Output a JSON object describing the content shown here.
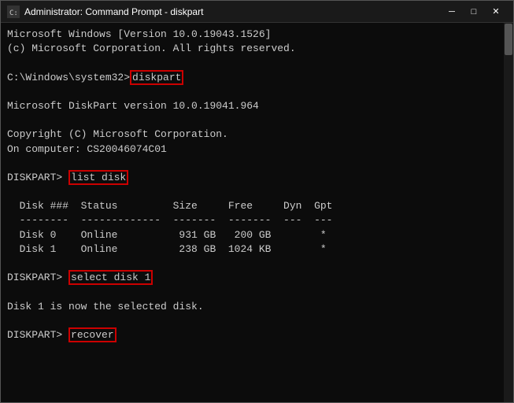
{
  "window": {
    "title": "Administrator: Command Prompt - diskpart",
    "icon": "▶"
  },
  "titlebar": {
    "minimize": "─",
    "maximize": "□",
    "close": "✕"
  },
  "terminal": {
    "lines": [
      {
        "id": "line1",
        "text": "Microsoft Windows [Version 10.0.19043.1526]",
        "highlight": null
      },
      {
        "id": "line2",
        "text": "(c) Microsoft Corporation. All rights reserved.",
        "highlight": null
      },
      {
        "id": "line3",
        "text": "",
        "highlight": null
      },
      {
        "id": "line4",
        "text": "C:\\Windows\\system32>diskpart",
        "highlight": "diskpart"
      },
      {
        "id": "line5",
        "text": "",
        "highlight": null
      },
      {
        "id": "line6",
        "text": "Microsoft DiskPart version 10.0.19041.964",
        "highlight": null
      },
      {
        "id": "line7",
        "text": "",
        "highlight": null
      },
      {
        "id": "line8",
        "text": "Copyright (C) Microsoft Corporation.",
        "highlight": null
      },
      {
        "id": "line9",
        "text": "On computer: CS20046074C01",
        "highlight": null
      },
      {
        "id": "line10",
        "text": "",
        "highlight": null
      },
      {
        "id": "line11",
        "text": "DISKPART> list disk",
        "highlight": "list disk"
      },
      {
        "id": "line12",
        "text": "",
        "highlight": null
      },
      {
        "id": "line13",
        "text": "  Disk ###  Status         Size     Free     Dyn  Gpt",
        "highlight": null
      },
      {
        "id": "line14",
        "text": "  --------  -------------  -------  -------  ---  ---",
        "highlight": null
      },
      {
        "id": "line15",
        "text": "  Disk 0    Online          931 GB   200 GB        *",
        "highlight": null
      },
      {
        "id": "line16",
        "text": "  Disk 1    Online          238 GB  1024 KB        *",
        "highlight": null
      },
      {
        "id": "line17",
        "text": "",
        "highlight": null
      },
      {
        "id": "line18",
        "text": "DISKPART> select disk 1",
        "highlight": "select disk 1"
      },
      {
        "id": "line19",
        "text": "",
        "highlight": null
      },
      {
        "id": "line20",
        "text": "Disk 1 is now the selected disk.",
        "highlight": null
      },
      {
        "id": "line21",
        "text": "",
        "highlight": null
      },
      {
        "id": "line22",
        "text": "DISKPART> recover",
        "highlight": "recover"
      }
    ]
  }
}
